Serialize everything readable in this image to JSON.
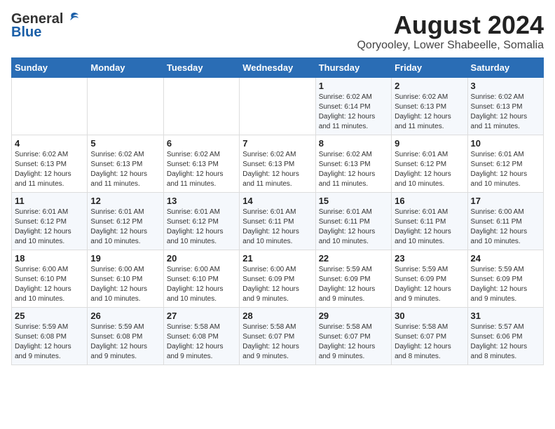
{
  "header": {
    "logo_general": "General",
    "logo_blue": "Blue",
    "month_year": "August 2024",
    "location": "Qoryooley, Lower Shabeelle, Somalia"
  },
  "days_of_week": [
    "Sunday",
    "Monday",
    "Tuesday",
    "Wednesday",
    "Thursday",
    "Friday",
    "Saturday"
  ],
  "weeks": [
    [
      {
        "day": "",
        "content": ""
      },
      {
        "day": "",
        "content": ""
      },
      {
        "day": "",
        "content": ""
      },
      {
        "day": "",
        "content": ""
      },
      {
        "day": "1",
        "content": "Sunrise: 6:02 AM\nSunset: 6:14 PM\nDaylight: 12 hours\nand 11 minutes."
      },
      {
        "day": "2",
        "content": "Sunrise: 6:02 AM\nSunset: 6:13 PM\nDaylight: 12 hours\nand 11 minutes."
      },
      {
        "day": "3",
        "content": "Sunrise: 6:02 AM\nSunset: 6:13 PM\nDaylight: 12 hours\nand 11 minutes."
      }
    ],
    [
      {
        "day": "4",
        "content": "Sunrise: 6:02 AM\nSunset: 6:13 PM\nDaylight: 12 hours\nand 11 minutes."
      },
      {
        "day": "5",
        "content": "Sunrise: 6:02 AM\nSunset: 6:13 PM\nDaylight: 12 hours\nand 11 minutes."
      },
      {
        "day": "6",
        "content": "Sunrise: 6:02 AM\nSunset: 6:13 PM\nDaylight: 12 hours\nand 11 minutes."
      },
      {
        "day": "7",
        "content": "Sunrise: 6:02 AM\nSunset: 6:13 PM\nDaylight: 12 hours\nand 11 minutes."
      },
      {
        "day": "8",
        "content": "Sunrise: 6:02 AM\nSunset: 6:13 PM\nDaylight: 12 hours\nand 11 minutes."
      },
      {
        "day": "9",
        "content": "Sunrise: 6:01 AM\nSunset: 6:12 PM\nDaylight: 12 hours\nand 10 minutes."
      },
      {
        "day": "10",
        "content": "Sunrise: 6:01 AM\nSunset: 6:12 PM\nDaylight: 12 hours\nand 10 minutes."
      }
    ],
    [
      {
        "day": "11",
        "content": "Sunrise: 6:01 AM\nSunset: 6:12 PM\nDaylight: 12 hours\nand 10 minutes."
      },
      {
        "day": "12",
        "content": "Sunrise: 6:01 AM\nSunset: 6:12 PM\nDaylight: 12 hours\nand 10 minutes."
      },
      {
        "day": "13",
        "content": "Sunrise: 6:01 AM\nSunset: 6:12 PM\nDaylight: 12 hours\nand 10 minutes."
      },
      {
        "day": "14",
        "content": "Sunrise: 6:01 AM\nSunset: 6:11 PM\nDaylight: 12 hours\nand 10 minutes."
      },
      {
        "day": "15",
        "content": "Sunrise: 6:01 AM\nSunset: 6:11 PM\nDaylight: 12 hours\nand 10 minutes."
      },
      {
        "day": "16",
        "content": "Sunrise: 6:01 AM\nSunset: 6:11 PM\nDaylight: 12 hours\nand 10 minutes."
      },
      {
        "day": "17",
        "content": "Sunrise: 6:00 AM\nSunset: 6:11 PM\nDaylight: 12 hours\nand 10 minutes."
      }
    ],
    [
      {
        "day": "18",
        "content": "Sunrise: 6:00 AM\nSunset: 6:10 PM\nDaylight: 12 hours\nand 10 minutes."
      },
      {
        "day": "19",
        "content": "Sunrise: 6:00 AM\nSunset: 6:10 PM\nDaylight: 12 hours\nand 10 minutes."
      },
      {
        "day": "20",
        "content": "Sunrise: 6:00 AM\nSunset: 6:10 PM\nDaylight: 12 hours\nand 10 minutes."
      },
      {
        "day": "21",
        "content": "Sunrise: 6:00 AM\nSunset: 6:09 PM\nDaylight: 12 hours\nand 9 minutes."
      },
      {
        "day": "22",
        "content": "Sunrise: 5:59 AM\nSunset: 6:09 PM\nDaylight: 12 hours\nand 9 minutes."
      },
      {
        "day": "23",
        "content": "Sunrise: 5:59 AM\nSunset: 6:09 PM\nDaylight: 12 hours\nand 9 minutes."
      },
      {
        "day": "24",
        "content": "Sunrise: 5:59 AM\nSunset: 6:09 PM\nDaylight: 12 hours\nand 9 minutes."
      }
    ],
    [
      {
        "day": "25",
        "content": "Sunrise: 5:59 AM\nSunset: 6:08 PM\nDaylight: 12 hours\nand 9 minutes."
      },
      {
        "day": "26",
        "content": "Sunrise: 5:59 AM\nSunset: 6:08 PM\nDaylight: 12 hours\nand 9 minutes."
      },
      {
        "day": "27",
        "content": "Sunrise: 5:58 AM\nSunset: 6:08 PM\nDaylight: 12 hours\nand 9 minutes."
      },
      {
        "day": "28",
        "content": "Sunrise: 5:58 AM\nSunset: 6:07 PM\nDaylight: 12 hours\nand 9 minutes."
      },
      {
        "day": "29",
        "content": "Sunrise: 5:58 AM\nSunset: 6:07 PM\nDaylight: 12 hours\nand 9 minutes."
      },
      {
        "day": "30",
        "content": "Sunrise: 5:58 AM\nSunset: 6:07 PM\nDaylight: 12 hours\nand 8 minutes."
      },
      {
        "day": "31",
        "content": "Sunrise: 5:57 AM\nSunset: 6:06 PM\nDaylight: 12 hours\nand 8 minutes."
      }
    ]
  ]
}
